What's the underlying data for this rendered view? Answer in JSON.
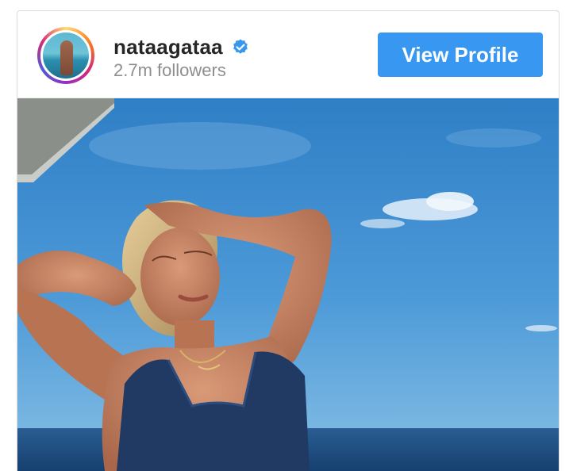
{
  "profile": {
    "username": "nataagataa",
    "followers": "2.7m followers",
    "verified_icon": "verified-badge-icon",
    "view_profile_label": "View Profile"
  },
  "colors": {
    "accent": "#3897f0",
    "username": "#262626",
    "secondary_text": "#8e8e8e",
    "sky": "#3f8fd2",
    "sea": "#1d4f86"
  }
}
